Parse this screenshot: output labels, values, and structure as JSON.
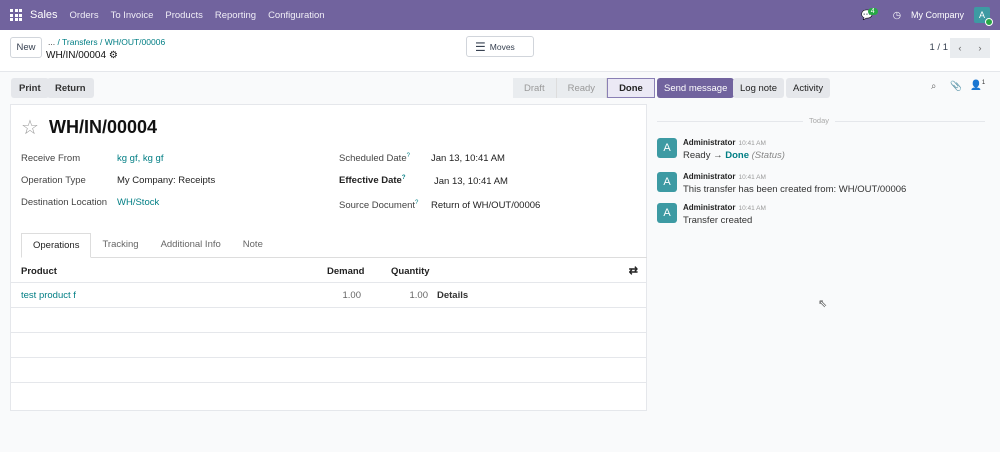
{
  "topbar": {
    "app": "Sales",
    "menus": [
      "Orders",
      "To Invoice",
      "Products",
      "Reporting",
      "Configuration"
    ],
    "messages_count": "4",
    "company": "My Company",
    "avatar": "A"
  },
  "control": {
    "new": "New",
    "breadcrumb_ellipsis": "...",
    "breadcrumb": [
      "Transfers",
      "WH/OUT/00006"
    ],
    "record": "WH/IN/00004",
    "moves": "Moves",
    "pager": "1 / 1"
  },
  "actions": {
    "print": "Print",
    "return": "Return"
  },
  "statusbar": {
    "steps": [
      "Draft",
      "Ready",
      "Done"
    ],
    "current": "Done"
  },
  "form": {
    "title": "WH/IN/00004",
    "left": [
      {
        "label": "Receive From",
        "value": "kg gf, kg gf"
      },
      {
        "label": "Operation Type",
        "value": "My Company: Receipts"
      },
      {
        "label": "Destination Location",
        "value": "WH/Stock"
      }
    ],
    "right": [
      {
        "label": "Scheduled Date",
        "help": "?",
        "value": "Jan 13, 10:41 AM"
      },
      {
        "label": "Effective Date",
        "help": "?",
        "value": "Jan 13, 10:41 AM"
      },
      {
        "label": "Source Document",
        "help": "?",
        "value": "Return of WH/OUT/00006"
      }
    ],
    "tabs": [
      "Operations",
      "Tracking",
      "Additional Info",
      "Note"
    ],
    "columns": [
      "Product",
      "Demand",
      "Quantity"
    ],
    "rows": [
      {
        "product": "test product f",
        "demand": "1.00",
        "quantity": "1.00",
        "details": "Details"
      }
    ]
  },
  "chatter": {
    "send": "Send message",
    "log": "Log note",
    "activity": "Activity",
    "followers": "1",
    "today": "Today",
    "messages": [
      {
        "author": "Administrator",
        "time": "10:41 AM",
        "from": "Ready",
        "to": "Done",
        "field": "(Status)"
      },
      {
        "author": "Administrator",
        "time": "10:41 AM",
        "body": "This transfer has been created from: WH/OUT/00006"
      },
      {
        "author": "Administrator",
        "time": "10:41 AM",
        "body": "Transfer created"
      }
    ]
  }
}
